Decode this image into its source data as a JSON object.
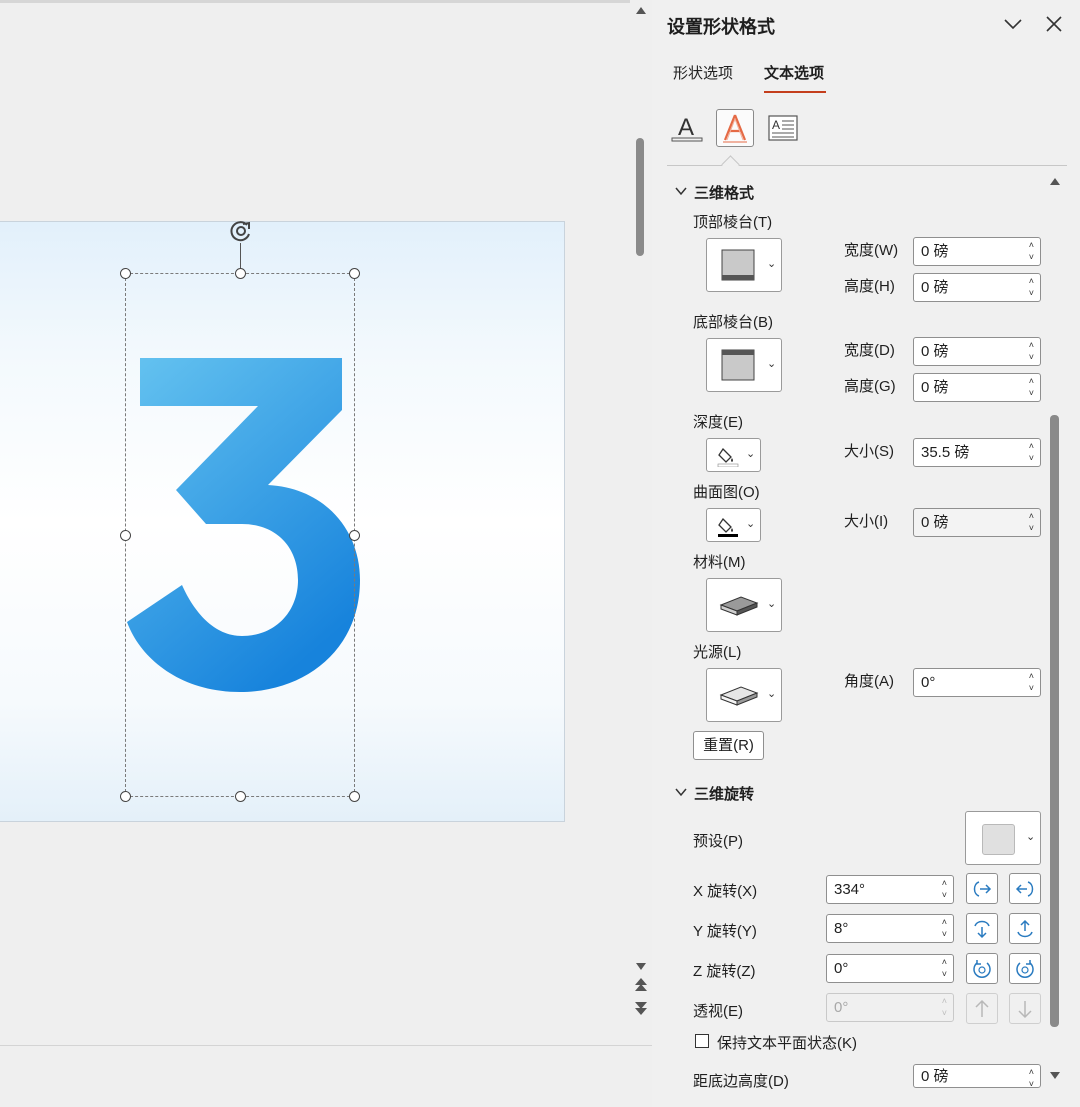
{
  "pane": {
    "title": "设置形状格式",
    "tabs": [
      "形状选项",
      "文本选项"
    ],
    "active_tab": "文本选项",
    "icon_tabs": [
      "text-fill-outline-icon",
      "text-effects-icon",
      "textbox-layout-icon"
    ],
    "accent_color": "#c43e1c"
  },
  "slide": {
    "big_text": "3",
    "text_colors": [
      "#61c0ef",
      "#1a84dc"
    ]
  },
  "format3d": {
    "header": "三维格式",
    "top_bevel": {
      "label": "顶部棱台(T)",
      "width_label": "宽度(W)",
      "width_value": "0 磅",
      "height_label": "高度(H)",
      "height_value": "0 磅"
    },
    "bottom_bevel": {
      "label": "底部棱台(B)",
      "width_label": "宽度(D)",
      "width_value": "0 磅",
      "height_label": "高度(G)",
      "height_value": "0 磅"
    },
    "depth": {
      "label": "深度(E)",
      "size_label": "大小(S)",
      "size_value": "35.5 磅"
    },
    "contour": {
      "label": "曲面图(O)",
      "size_label": "大小(I)",
      "size_value": "0 磅"
    },
    "material": {
      "label": "材料(M)"
    },
    "lighting": {
      "label": "光源(L)",
      "angle_label": "角度(A)",
      "angle_value": "0°"
    },
    "reset_label": "重置(R)"
  },
  "rotation3d": {
    "header": "三维旋转",
    "preset_label": "预设(P)",
    "x_label": "X 旋转(X)",
    "x_value": "334°",
    "y_label": "Y 旋转(Y)",
    "y_value": "8°",
    "z_label": "Z 旋转(Z)",
    "z_value": "0°",
    "perspective_label": "透视(E)",
    "perspective_value": "0°",
    "keep_flat_label": "保持文本平面状态(K)",
    "distance_label": "距底边高度(D)",
    "distance_value": "0 磅"
  }
}
